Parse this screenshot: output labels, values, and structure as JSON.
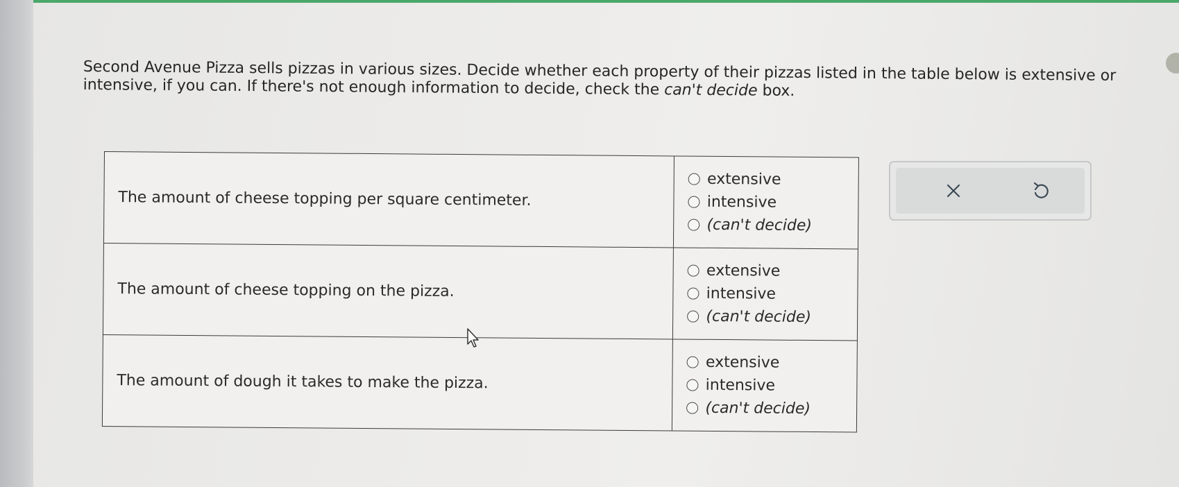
{
  "prompt": {
    "line1": "Second Avenue Pizza sells pizzas in various sizes. Decide whether each property of their pizzas listed in the table below is extensive or",
    "line2_start": "intensive, if you can. If there's not enough information to decide, check the ",
    "line2_emph": "can't decide",
    "line2_end": " box."
  },
  "questions": [
    {
      "property": "The amount of cheese topping per square centimeter.",
      "options": [
        "extensive",
        "intensive",
        "(can't decide)"
      ]
    },
    {
      "property": "The amount of cheese topping on the pizza.",
      "options": [
        "extensive",
        "intensive",
        "(can't decide)"
      ]
    },
    {
      "property": "The amount of dough it takes to make the pizza.",
      "options": [
        "extensive",
        "intensive",
        "(can't decide)"
      ]
    }
  ],
  "actions": {
    "clear_icon": "close-icon",
    "undo_icon": "undo-icon"
  },
  "colors": {
    "accent_bar": "#4aa86a"
  }
}
